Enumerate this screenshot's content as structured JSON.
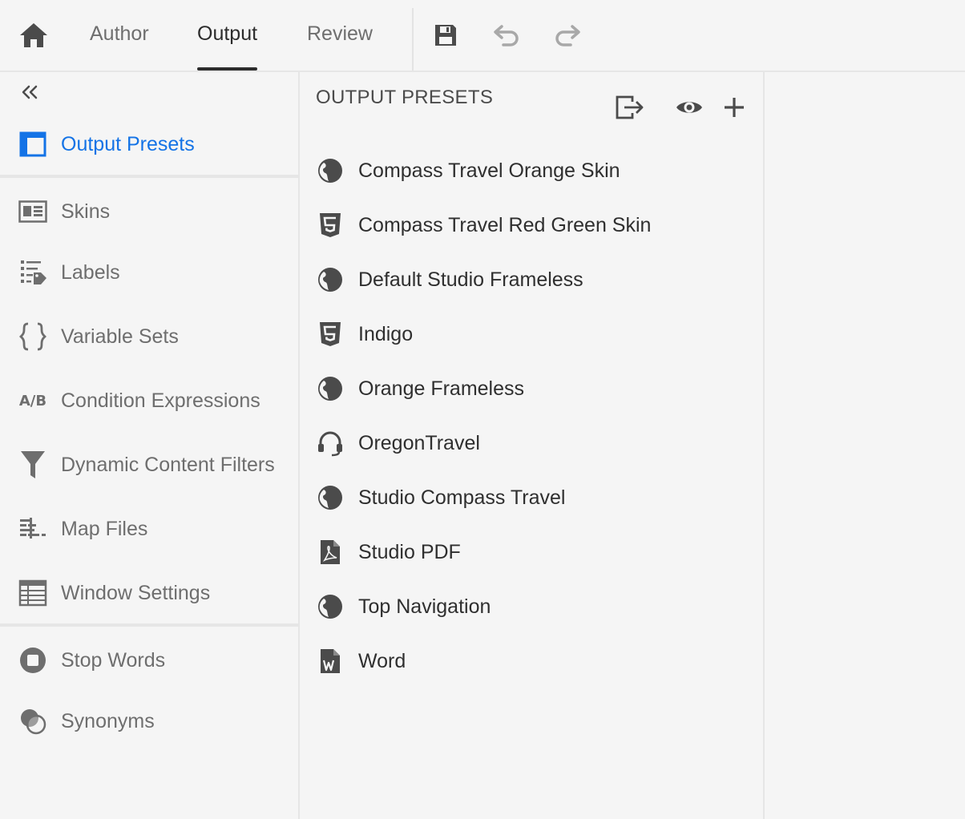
{
  "topbar": {
    "home_icon": "home-icon",
    "tabs": [
      {
        "label": "Author",
        "active": false
      },
      {
        "label": "Output",
        "active": true
      },
      {
        "label": "Review",
        "active": false
      }
    ],
    "tools": [
      "save-icon",
      "undo-icon",
      "redo-icon"
    ]
  },
  "sidebar": {
    "collapse_icon": "double-chevron-left-icon",
    "items": [
      {
        "label": "Output Presets",
        "icon": "output-presets-icon",
        "active": true
      },
      {
        "label": "Skins",
        "icon": "skins-icon",
        "active": false
      },
      {
        "label": "Labels",
        "icon": "labels-icon",
        "active": false
      },
      {
        "label": "Variable Sets",
        "icon": "braces-icon",
        "active": false
      },
      {
        "label": "Condition Expressions",
        "icon": "ab-icon",
        "active": false
      },
      {
        "label": "Dynamic Content Filters",
        "icon": "filter-icon",
        "active": false
      },
      {
        "label": "Map Files",
        "icon": "map-files-icon",
        "active": false
      },
      {
        "label": "Window Settings",
        "icon": "table-icon",
        "active": false
      },
      {
        "label": "Stop Words",
        "icon": "stop-icon",
        "active": false
      },
      {
        "label": "Synonyms",
        "icon": "synonyms-icon",
        "active": false
      }
    ]
  },
  "panel": {
    "title": "OUTPUT PRESETS",
    "actions": [
      "export-icon",
      "preview-eye-icon",
      "add-icon"
    ],
    "presets": [
      {
        "label": "Compass Travel Orange Skin",
        "icon": "globe-icon"
      },
      {
        "label": "Compass Travel Red Green Skin",
        "icon": "html5-icon"
      },
      {
        "label": "Default Studio Frameless",
        "icon": "globe-icon"
      },
      {
        "label": "Indigo",
        "icon": "html5-icon"
      },
      {
        "label": "Orange Frameless",
        "icon": "globe-icon"
      },
      {
        "label": "OregonTravel",
        "icon": "headset-icon"
      },
      {
        "label": "Studio Compass Travel",
        "icon": "globe-icon"
      },
      {
        "label": "Studio PDF",
        "icon": "pdf-icon"
      },
      {
        "label": "Top Navigation",
        "icon": "globe-icon"
      },
      {
        "label": "Word",
        "icon": "word-icon"
      }
    ]
  },
  "colors": {
    "accent": "#1473e6",
    "text": "#2f2f2f",
    "muted": "#6e6e6e",
    "background": "#f5f5f5",
    "divider": "#e6e6e6"
  }
}
